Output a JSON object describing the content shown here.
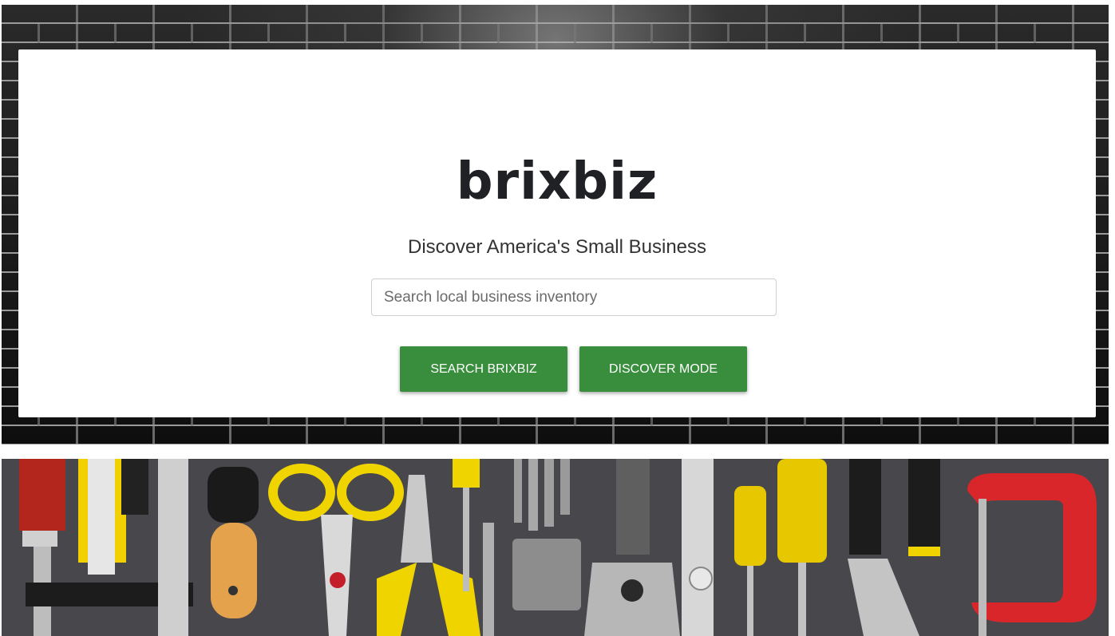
{
  "hero": {
    "logo_text": "brixbiz",
    "tagline": "Discover America's Small Business",
    "search": {
      "placeholder": "Search local business inventory",
      "value": ""
    },
    "buttons": {
      "search_label": "SEARCH BRIXBIZ",
      "discover_label": "DISCOVER MODE"
    }
  },
  "colors": {
    "button_green": "#388e3c",
    "logo_text": "#202124",
    "brick_dark": "#121212"
  },
  "banner": {
    "image": "tools-on-gray-board",
    "icons": [
      "utility-knife-icon",
      "scissors-icon",
      "screwdriver-icon",
      "pliers-icon",
      "drill-bits-icon",
      "wrench-icon",
      "caliper-icon",
      "c-clamp-icon"
    ]
  }
}
